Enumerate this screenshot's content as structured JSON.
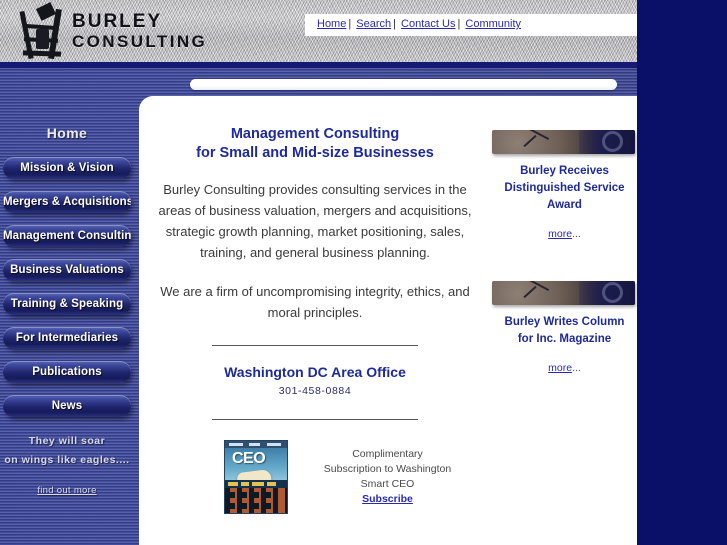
{
  "site": {
    "logo_line1": "BURLEY",
    "logo_line2": "CONSULTING",
    "logo_icon": "oil-derrick-icon"
  },
  "topnav": {
    "items": [
      {
        "label": "Home"
      },
      {
        "label": "Search"
      },
      {
        "label": "Contact Us"
      },
      {
        "label": "Community"
      }
    ],
    "separator": "|"
  },
  "sidebar": {
    "current": "Home",
    "items": [
      {
        "label": "Mission & Vision"
      },
      {
        "label": "Mergers & Acquisitions"
      },
      {
        "label": "Management Consulting"
      },
      {
        "label": "Business Valuations"
      },
      {
        "label": "Training & Speaking"
      },
      {
        "label": "For Intermediaries"
      },
      {
        "label": "Publications"
      },
      {
        "label": "News"
      }
    ],
    "quote_line1": "They will soar",
    "quote_line2": "on wings like eagles....",
    "quote_link": "find out more"
  },
  "main": {
    "heading_line1": "Management Consulting",
    "heading_line2": "for Small and Mid-size Businesses",
    "paragraph1": "Burley Consulting provides consulting services in the areas of business valuation, mergers and acquisitions, strategic growth planning, market positioning, sales, training, and general business planning.",
    "paragraph2": "We are a firm of uncompromising integrity, ethics, and moral principles.",
    "office_name": "Washington DC Area Office",
    "office_phone": "301-458-0884"
  },
  "subscribe": {
    "cover_alt": "washington-smart-ceo-magazine-cover",
    "cover_title": "CEO",
    "line1": "Complimentary",
    "line2": "Subscription to Washington",
    "line3": "Smart CEO",
    "link": "Subscribe"
  },
  "promos": [
    {
      "image_alt": "clock-photo",
      "title_line1": "Burley Receives",
      "title_line2": "Distinguished Service",
      "title_line3": "Award",
      "more_label": "more",
      "more_suffix": "..."
    },
    {
      "image_alt": "clock-photo",
      "title_line1": "Burley Writes Column",
      "title_line2": "for Inc. Magazine",
      "title_line3": "",
      "more_label": "more",
      "more_suffix": "..."
    }
  ],
  "colors": {
    "page_background": "#0a0f68",
    "sidebar_blue": "#3a4490",
    "heading_blue": "#1e2a9c",
    "link_blue": "#2a2ab8",
    "masthead_silver": "#c0c0c5"
  }
}
